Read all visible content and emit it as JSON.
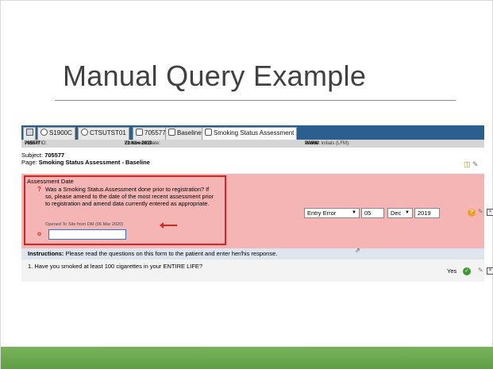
{
  "slide": {
    "title": "Manual Query Example",
    "accent_color": "#6aa84f"
  },
  "tabs": [
    {
      "label": "",
      "icon": "home-icon"
    },
    {
      "label": "S1900C",
      "icon": "study-icon"
    },
    {
      "label": "CTSUTST01",
      "icon": "site-icon"
    },
    {
      "label": "705577",
      "icon": "patient-icon"
    },
    {
      "label": "Baseline",
      "icon": "folder-icon"
    },
    {
      "label": "Smoking Status Assessment",
      "icon": "form-icon"
    }
  ],
  "infobar": {
    "patient_id_label": "Patient ID:",
    "patient_id": "705577",
    "enrollment_label": "Enrollment Date:",
    "enrollment_date": "22 Nov 2019",
    "initials_label": "Patient Initials (LFM):",
    "initials": "WWW"
  },
  "subject": {
    "subject_label": "Subject:",
    "subject_value": "705577",
    "page_label": "Page:",
    "page_value": "Smoking Status Assessment - Baseline"
  },
  "query": {
    "field_title": "Assessment Date",
    "question_mark": "?",
    "question": "Was a Smoking Status Assessment done prior to registration? If so, please amend to the date of the most recent assessment prior to registration and amend data currently entered as appropriate.",
    "opened_note": "Opened To Site from DM (06 Mar 2020)",
    "response_mark": "o",
    "response_value": ""
  },
  "date_field": {
    "reason": "Entry Error",
    "day": "05",
    "month": "Dec",
    "year": "2019"
  },
  "instructions": {
    "label": "Instructions:",
    "text": "Please read the questions on this form to the patient and enter her/his response."
  },
  "question1": {
    "text": "1. Have you smoked at least 100 cigarettes in your ENTIRE LIFE?",
    "answer": "Yes"
  }
}
